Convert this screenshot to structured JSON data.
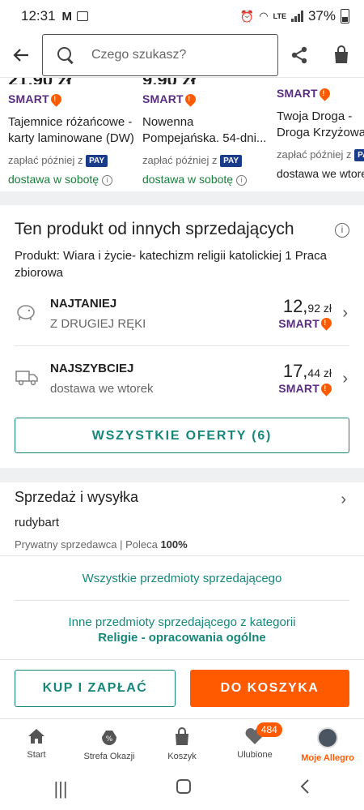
{
  "status_bar": {
    "time": "12:31",
    "network": "LTE",
    "battery": "37%"
  },
  "header": {
    "search_placeholder": "Czego szukasz?"
  },
  "carousel": [
    {
      "smart": "SMART",
      "title": "Tajemnice różańcowe - karty laminowane (DW)",
      "pay_later": "zapłać później z",
      "pay_badge": "PAY",
      "delivery": "dostawa w sobotę"
    },
    {
      "smart": "SMART",
      "title": "Nowenna Pompejańska. 54-dni...",
      "pay_later": "zapłać później z",
      "pay_badge": "PAY",
      "delivery": "dostawa w sobotę"
    },
    {
      "smart": "SMART",
      "title": "Twoja Droga - Droga Krzyżowa. Ks. D...",
      "pay_later": "zapłać później z",
      "pay_badge": "PAY",
      "delivery": "dostawa we wtorek"
    }
  ],
  "offers": {
    "heading": "Ten produkt od innych sprzedających",
    "product": "Produkt: Wiara i życie- katechizm religii katolickiej 1 Praca zbiorowa",
    "rows": [
      {
        "title": "NAJTANIEJ",
        "subtitle": "Z DRUGIEJ RĘKI",
        "price_main": "12,",
        "price_cents": "92 zł",
        "smart": "SMART"
      },
      {
        "title": "NAJSZYBCIEJ",
        "subtitle": "dostawa we wtorek",
        "price_main": "17,",
        "price_cents": "44 zł",
        "smart": "SMART"
      }
    ],
    "all_button": "WSZYSTKIE OFERTY (6)"
  },
  "seller": {
    "title": "Sprzedaż i wysyłka",
    "name": "rudybart",
    "type": "Prywatny sprzedawca",
    "recommend_label": "Poleca",
    "recommend_value": "100%",
    "all_items_link": "Wszystkie przedmioty sprzedającego",
    "category_link_prefix": "Inne przedmioty sprzedającego z kategorii",
    "category_link_name": "Religie - opracowania ogólne"
  },
  "actions": {
    "buy_now": "KUP I ZAPŁAĆ",
    "add_to_cart": "DO KOSZYKA"
  },
  "bottom_nav": [
    {
      "label": "Start",
      "icon": "home-icon"
    },
    {
      "label": "Strefa Okazji",
      "icon": "percent-bag-icon"
    },
    {
      "label": "Koszyk",
      "icon": "cart-icon"
    },
    {
      "label": "Ulubione",
      "icon": "heart-icon",
      "badge": "484"
    },
    {
      "label": "Moje Allegro",
      "icon": "avatar"
    }
  ],
  "colors": {
    "accent": "#17877a",
    "brand_orange": "#ff5a00",
    "smart_purple": "#5a2d82",
    "delivery_green": "#1a7f3c"
  }
}
